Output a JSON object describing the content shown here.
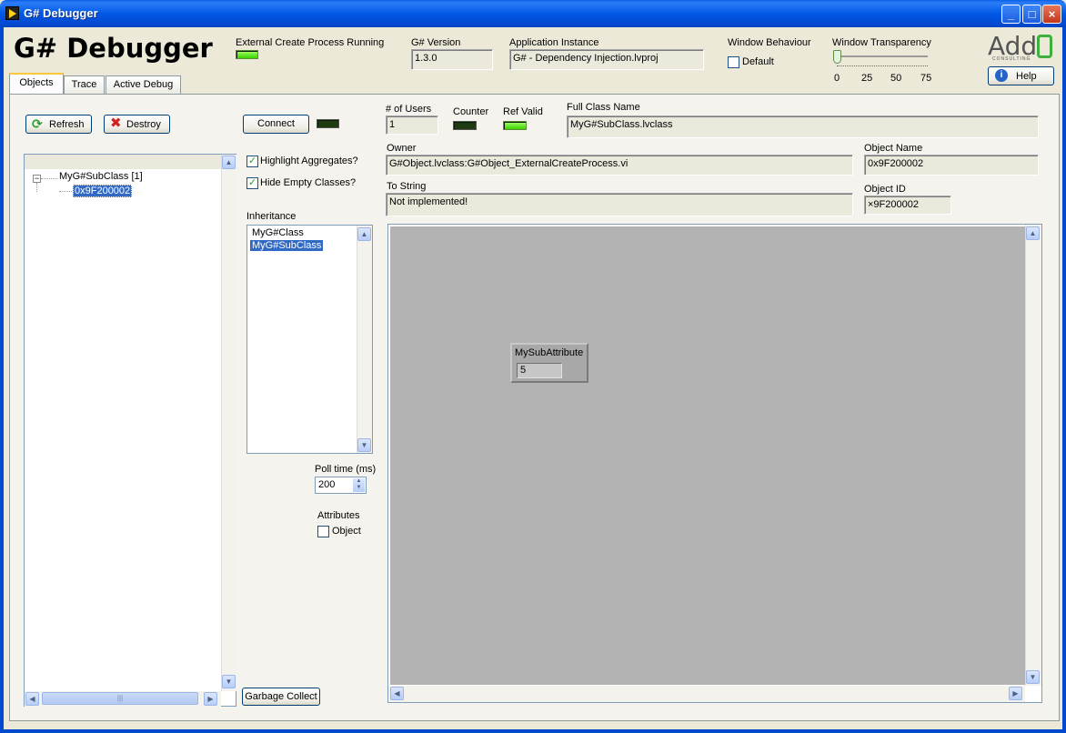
{
  "window": {
    "title": "G# Debugger"
  },
  "header": {
    "app_title": "G# Debugger",
    "external_process_label": "External Create Process Running",
    "version_label": "G# Version",
    "version_value": "1.3.0",
    "app_instance_label": "Application Instance",
    "app_instance_value": "G# - Dependency Injection.lvproj",
    "window_behaviour_label": "Window Behaviour",
    "default_label": "Default",
    "transparency_label": "Window Transparency",
    "transparency_ticks": [
      "0",
      "25",
      "50",
      "75"
    ],
    "transparency_value": 0,
    "logo_text": "Add",
    "logo_sub": "CONSULTING",
    "help_label": "Help"
  },
  "tabs": [
    {
      "label": "Objects",
      "active": true
    },
    {
      "label": "Trace",
      "active": false
    },
    {
      "label": "Active Debug",
      "active": false
    }
  ],
  "objects": {
    "refresh_label": "Refresh",
    "destroy_label": "Destroy",
    "tree": {
      "root": "MyG#SubClass [1]",
      "child": "0x9F200002"
    },
    "connect_label": "Connect",
    "highlight_aggregates_label": "Highlight Aggregates?",
    "hide_empty_label": "Hide Empty Classes?",
    "inheritance_label": "Inheritance",
    "inheritance": [
      "MyG#Class",
      "MyG#SubClass"
    ],
    "poll_time_label": "Poll time (ms)",
    "poll_time_value": "200",
    "attributes_label": "Attributes",
    "object_label": "Object",
    "garbage_collect_label": "Garbage Collect",
    "users_label": "# of Users",
    "users_value": "1",
    "counter_label": "Counter",
    "ref_valid_label": "Ref Valid",
    "full_class_label": "Full Class Name",
    "full_class_value": "MyG#SubClass.lvclass",
    "owner_label": "Owner",
    "owner_value": "G#Object.lvclass:G#Object_ExternalCreateProcess.vi",
    "object_name_label": "Object Name",
    "object_name_value": "0x9F200002",
    "to_string_label": "To String",
    "to_string_value": "Not implemented!",
    "object_id_label": "Object ID",
    "object_id_value": "×9F200002",
    "attribute_cluster_label": "MySubAttribute",
    "attribute_cluster_value": "5"
  },
  "colors": {
    "titlebar": "#0058e6",
    "led_on": "#39d400",
    "led_off": "#1f3b12",
    "selection": "#316ac5",
    "attribute_area": "#b3b3b3"
  }
}
